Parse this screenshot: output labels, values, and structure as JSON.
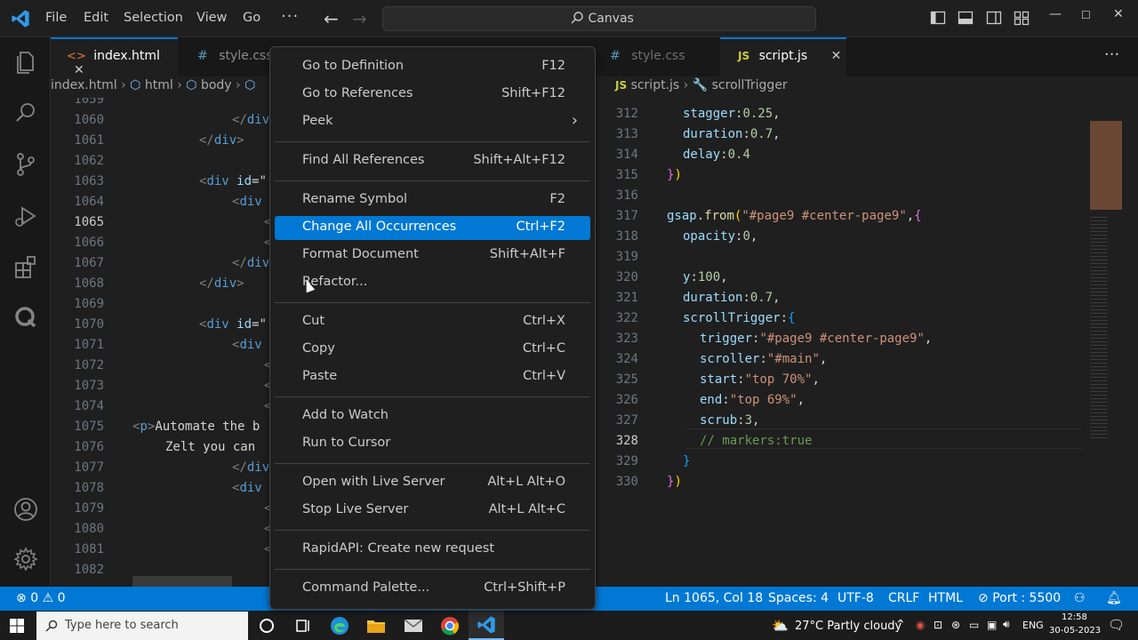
{
  "titlebar": {
    "menus": [
      "File",
      "Edit",
      "Selection",
      "View",
      "Go"
    ],
    "more": "···",
    "command_center": "Canvas"
  },
  "left_tabs": [
    {
      "label": "index.html",
      "icon": "<>",
      "close": "✕"
    },
    {
      "label": "style.css",
      "icon": "#"
    }
  ],
  "left_breadcrumb": {
    "file": "index.html",
    "items": [
      "html",
      "body"
    ]
  },
  "left_code": [
    {
      "ln": "1059",
      "html": ""
    },
    {
      "ln": "1060",
      "indent": 112,
      "parts": [
        [
          "tagc",
          "</"
        ],
        [
          "kw",
          "div"
        ]
      ]
    },
    {
      "ln": "1061",
      "indent": 75,
      "parts": [
        [
          "tagc",
          "</"
        ],
        [
          "kw",
          "div"
        ],
        [
          "tagc",
          ">"
        ]
      ]
    },
    {
      "ln": "1062",
      "indent": 0,
      "parts": []
    },
    {
      "ln": "1063",
      "indent": 75,
      "parts": [
        [
          "tagc",
          "<"
        ],
        [
          "kw",
          "div"
        ],
        [
          "plain",
          " "
        ],
        [
          "attr",
          "id"
        ],
        [
          "plain",
          "=\""
        ]
      ]
    },
    {
      "ln": "1064",
      "indent": 112,
      "parts": [
        [
          "tagc",
          "<"
        ],
        [
          "kw",
          "div"
        ]
      ]
    },
    {
      "ln": "1065",
      "indent": 148,
      "parts": [
        [
          "tagc",
          "<"
        ]
      ]
    },
    {
      "ln": "1066",
      "indent": 148,
      "parts": [
        [
          "tagc",
          "<"
        ]
      ]
    },
    {
      "ln": "1067",
      "indent": 112,
      "parts": [
        [
          "tagc",
          "</"
        ],
        [
          "kw",
          "div"
        ]
      ]
    },
    {
      "ln": "1068",
      "indent": 75,
      "parts": [
        [
          "tagc",
          "</"
        ],
        [
          "kw",
          "div"
        ],
        [
          "tagc",
          ">"
        ]
      ]
    },
    {
      "ln": "1069",
      "indent": 0,
      "parts": []
    },
    {
      "ln": "1070",
      "indent": 75,
      "parts": [
        [
          "tagc",
          "<"
        ],
        [
          "kw",
          "div"
        ],
        [
          "plain",
          " "
        ],
        [
          "attr",
          "id"
        ],
        [
          "plain",
          "=\""
        ]
      ]
    },
    {
      "ln": "1071",
      "indent": 112,
      "parts": [
        [
          "tagc",
          "<"
        ],
        [
          "kw",
          "div"
        ]
      ]
    },
    {
      "ln": "1072",
      "indent": 148,
      "parts": [
        [
          "tagc",
          "<"
        ]
      ]
    },
    {
      "ln": "1073",
      "indent": 148,
      "parts": [
        [
          "tagc",
          "<"
        ]
      ]
    },
    {
      "ln": "1074",
      "indent": 148,
      "parts": [
        [
          "tagc",
          "<"
        ]
      ]
    },
    {
      "ln": "1075",
      "indent": 0,
      "parts": [
        [
          "tagc",
          "<"
        ],
        [
          "kw",
          "p"
        ],
        [
          "tagc",
          ">"
        ],
        [
          "plain",
          "Automate the b"
        ]
      ]
    },
    {
      "ln": "1076",
      "indent": 37,
      "parts": [
        [
          "plain",
          "Zelt you can "
        ]
      ]
    },
    {
      "ln": "1077",
      "indent": 112,
      "parts": [
        [
          "tagc",
          "</"
        ],
        [
          "kw",
          "div"
        ]
      ]
    },
    {
      "ln": "1078",
      "indent": 112,
      "parts": [
        [
          "tagc",
          "<"
        ],
        [
          "kw",
          "div"
        ]
      ]
    },
    {
      "ln": "1079",
      "indent": 148,
      "parts": [
        [
          "tagc",
          "<"
        ]
      ]
    },
    {
      "ln": "1080",
      "indent": 148,
      "parts": [
        [
          "tagc",
          "<"
        ]
      ]
    },
    {
      "ln": "1081",
      "indent": 148,
      "parts": [
        [
          "tagc",
          "<"
        ]
      ]
    },
    {
      "ln": "1082",
      "indent": 0,
      "parts": []
    }
  ],
  "right_tabs": [
    {
      "label": "style.css",
      "icon": "#"
    },
    {
      "label": "script.js",
      "icon": "JS",
      "close": "✕"
    }
  ],
  "right_breadcrumb": {
    "file": "script.js",
    "icon": "JS",
    "item": "scrollTrigger"
  },
  "right_code": [
    {
      "ln": "312",
      "indent": 18,
      "parts": [
        [
          "attr",
          "stagger"
        ],
        [
          "plain",
          ":"
        ],
        [
          "num",
          "0.25"
        ],
        [
          "plain",
          ","
        ]
      ]
    },
    {
      "ln": "313",
      "indent": 18,
      "parts": [
        [
          "attr",
          "duration"
        ],
        [
          "plain",
          ":"
        ],
        [
          "num",
          "0.7"
        ],
        [
          "plain",
          ","
        ]
      ]
    },
    {
      "ln": "314",
      "indent": 18,
      "parts": [
        [
          "attr",
          "delay"
        ],
        [
          "plain",
          ":"
        ],
        [
          "num",
          "0.4"
        ]
      ]
    },
    {
      "ln": "315",
      "indent": 0,
      "parts": [
        [
          "brace2",
          "}"
        ],
        [
          "brace",
          ")"
        ]
      ]
    },
    {
      "ln": "316",
      "indent": 0,
      "parts": []
    },
    {
      "ln": "317",
      "indent": 0,
      "parts": [
        [
          "attr",
          "gsap"
        ],
        [
          "plain",
          "."
        ],
        [
          "fn",
          "from"
        ],
        [
          "brace",
          "("
        ],
        [
          "str",
          "\"#page9 #center-page9\""
        ],
        [
          "plain",
          ","
        ],
        [
          "brace2",
          "{"
        ]
      ]
    },
    {
      "ln": "318",
      "indent": 18,
      "parts": [
        [
          "attr",
          "opacity"
        ],
        [
          "plain",
          ":"
        ],
        [
          "num",
          "0"
        ],
        [
          "plain",
          ","
        ]
      ]
    },
    {
      "ln": "319",
      "indent": 0,
      "parts": []
    },
    {
      "ln": "320",
      "indent": 18,
      "parts": [
        [
          "attr",
          "y"
        ],
        [
          "plain",
          ":"
        ],
        [
          "num",
          "100"
        ],
        [
          "plain",
          ","
        ]
      ]
    },
    {
      "ln": "321",
      "indent": 18,
      "parts": [
        [
          "attr",
          "duration"
        ],
        [
          "plain",
          ":"
        ],
        [
          "num",
          "0.7"
        ],
        [
          "plain",
          ","
        ]
      ]
    },
    {
      "ln": "322",
      "indent": 18,
      "parts": [
        [
          "attr",
          "scrollTrigger"
        ],
        [
          "plain",
          ":"
        ],
        [
          "brace3",
          "{"
        ]
      ]
    },
    {
      "ln": "323",
      "indent": 37,
      "parts": [
        [
          "attr",
          "trigger"
        ],
        [
          "plain",
          ":"
        ],
        [
          "str",
          "\"#page9 #center-page9\""
        ],
        [
          "plain",
          ","
        ]
      ]
    },
    {
      "ln": "324",
      "indent": 37,
      "parts": [
        [
          "attr",
          "scroller"
        ],
        [
          "plain",
          ":"
        ],
        [
          "str",
          "\"#main\""
        ],
        [
          "plain",
          ","
        ]
      ]
    },
    {
      "ln": "325",
      "indent": 37,
      "parts": [
        [
          "attr",
          "start"
        ],
        [
          "plain",
          ":"
        ],
        [
          "str",
          "\"top 70%\""
        ],
        [
          "plain",
          ","
        ]
      ]
    },
    {
      "ln": "326",
      "indent": 37,
      "parts": [
        [
          "attr",
          "end"
        ],
        [
          "plain",
          ":"
        ],
        [
          "str",
          "\"top 69%\""
        ],
        [
          "plain",
          ","
        ]
      ]
    },
    {
      "ln": "327",
      "indent": 37,
      "parts": [
        [
          "attr",
          "scrub"
        ],
        [
          "plain",
          ":"
        ],
        [
          "num",
          "3"
        ],
        [
          "plain",
          ","
        ]
      ]
    },
    {
      "ln": "328",
      "indent": 37,
      "parts": [
        [
          "cmt",
          "// markers:true"
        ]
      ]
    },
    {
      "ln": "329",
      "indent": 18,
      "parts": [
        [
          "brace3",
          "}"
        ]
      ]
    },
    {
      "ln": "330",
      "indent": 0,
      "parts": [
        [
          "brace2",
          "}"
        ],
        [
          "brace",
          ")"
        ]
      ]
    }
  ],
  "context_menu": {
    "groups": [
      [
        {
          "label": "Go to Definition",
          "key": "F12"
        },
        {
          "label": "Go to References",
          "key": "Shift+F12"
        },
        {
          "label": "Peek",
          "key": "",
          "submenu": "›"
        }
      ],
      [
        {
          "label": "Find All References",
          "key": "Shift+Alt+F12"
        }
      ],
      [
        {
          "label": "Rename Symbol",
          "key": "F2"
        },
        {
          "label": "Change All Occurrences",
          "key": "Ctrl+F2",
          "highlight": true
        },
        {
          "label": "Format Document",
          "key": "Shift+Alt+F"
        },
        {
          "label": "Refactor...",
          "key": ""
        }
      ],
      [
        {
          "label": "Cut",
          "key": "Ctrl+X"
        },
        {
          "label": "Copy",
          "key": "Ctrl+C"
        },
        {
          "label": "Paste",
          "key": "Ctrl+V"
        }
      ],
      [
        {
          "label": "Add to Watch",
          "key": ""
        },
        {
          "label": "Run to Cursor",
          "key": ""
        }
      ],
      [
        {
          "label": "Open with Live Server",
          "key": "Alt+L Alt+O"
        },
        {
          "label": "Stop Live Server",
          "key": "Alt+L Alt+C"
        }
      ],
      [
        {
          "label": "RapidAPI: Create new request",
          "key": ""
        }
      ],
      [
        {
          "label": "Command Palette...",
          "key": "Ctrl+Shift+P"
        }
      ]
    ]
  },
  "statusbar": {
    "errors": "0",
    "warnings": "0",
    "position": "Ln 1065, Col 18",
    "spaces": "Spaces: 4",
    "encoding": "UTF-8",
    "eol": "CRLF",
    "language": "HTML",
    "port": "Port : 5500"
  },
  "taskbar": {
    "search_placeholder": "Type here to search",
    "weather": "27°C  Partly cloudy",
    "lang": "ENG",
    "time": "12:58",
    "date": "30-05-2023"
  },
  "colors": {
    "accent": "#0078d4",
    "editor_bg": "#1f1f1f"
  }
}
